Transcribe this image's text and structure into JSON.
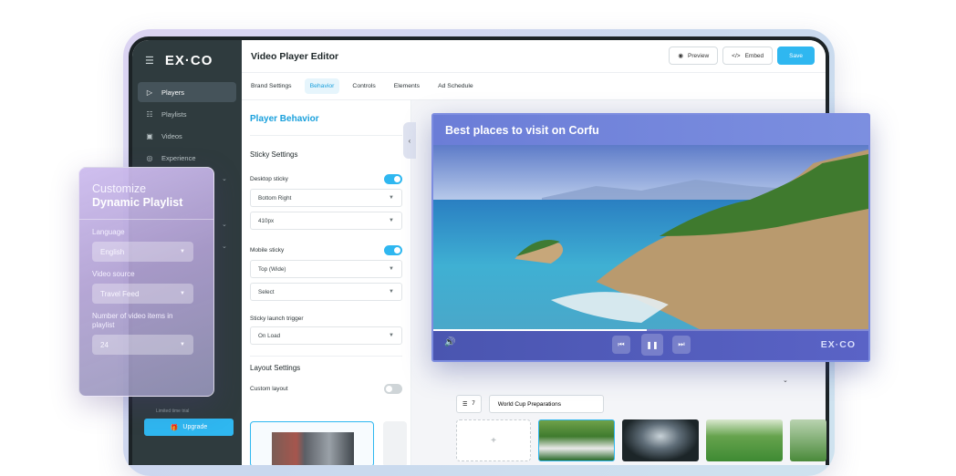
{
  "app": {
    "logo": "EX·CO",
    "title": "Video Player Editor"
  },
  "sidebar": {
    "items": [
      {
        "label": "Players",
        "icon": "play-icon"
      },
      {
        "label": "Playlists",
        "icon": "list-icon"
      },
      {
        "label": "Videos",
        "icon": "video-icon"
      },
      {
        "label": "Experience",
        "icon": "experience-icon"
      }
    ],
    "upgrade_note": "Limited time trial",
    "upgrade_label": "Upgrade"
  },
  "toolbar": {
    "preview_label": "Preview",
    "embed_label": "Embed",
    "save_label": "Save"
  },
  "tabs": [
    {
      "label": "Brand Settings",
      "active": false
    },
    {
      "label": "Behavior",
      "active": true
    },
    {
      "label": "Controls",
      "active": false
    },
    {
      "label": "Elements",
      "active": false
    },
    {
      "label": "Ad Schedule",
      "active": false
    }
  ],
  "panel": {
    "title": "Player Behavior",
    "sticky_section": "Sticky Settings",
    "desktop_sticky_label": "Desktop sticky",
    "desktop_sticky_on": true,
    "desktop_position": "Bottom Right",
    "desktop_size": "410px",
    "mobile_sticky_label": "Mobile sticky",
    "mobile_sticky_on": true,
    "mobile_position": "Top (Wide)",
    "mobile_select": "Select",
    "trigger_label": "Sticky launch trigger",
    "trigger_value": "On Load",
    "layout_section": "Layout Settings",
    "custom_layout_label": "Custom layout",
    "custom_layout_on": false
  },
  "player": {
    "title": "Best places to visit on Corfu",
    "progress": 0.49,
    "logo": "EX·CO"
  },
  "playlist_strip": {
    "count": "7",
    "name": "World Cup Preparations",
    "add_label": "+"
  },
  "overlay_card": {
    "heading_light": "Customize",
    "heading_bold": "Dynamic Playlist",
    "language_label": "Language",
    "language_value": "English",
    "source_label": "Video source",
    "source_value": "Travel Feed",
    "items_label": "Number of video items in playlist",
    "items_value": "24"
  },
  "colors": {
    "accent": "#2fb7f0",
    "sidebar_bg": "#2f3b3e",
    "player_bar": "#4a55b0"
  }
}
